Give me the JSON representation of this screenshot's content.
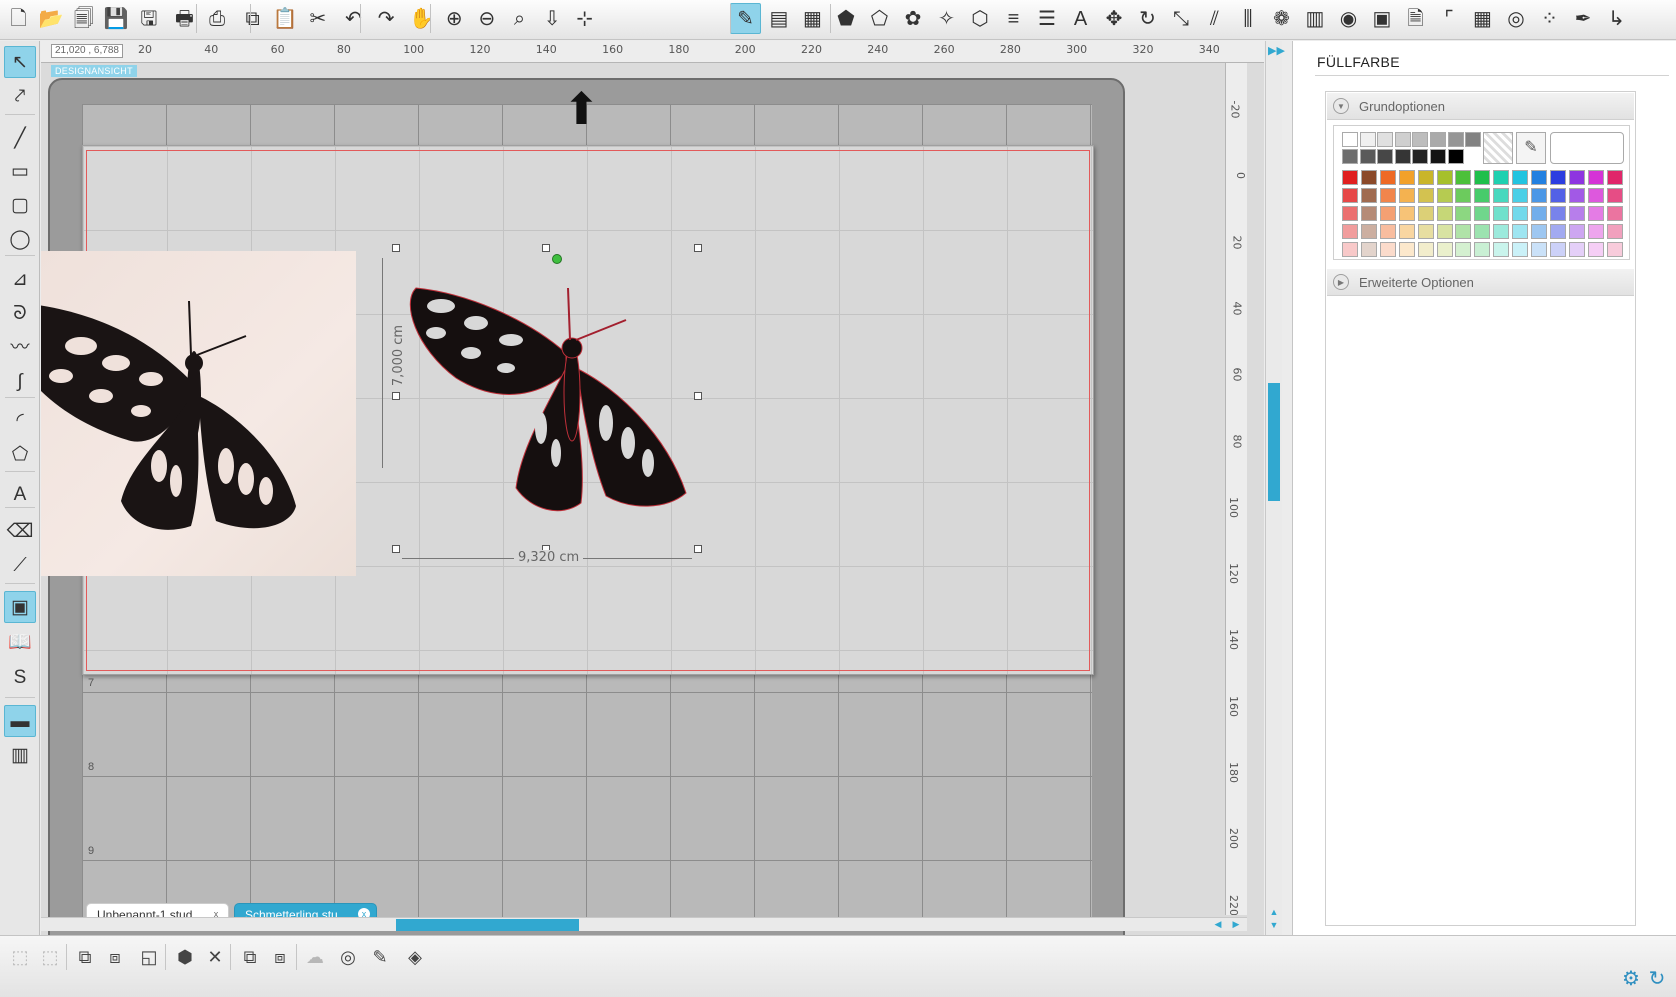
{
  "toolbar_left": [
    {
      "name": "new-document-icon",
      "glyph": "🗋"
    },
    {
      "name": "open-folder-icon",
      "glyph": "📂"
    },
    {
      "name": "open-template-icon",
      "glyph": "🗐"
    },
    {
      "name": "save-icon",
      "glyph": "💾"
    },
    {
      "name": "save-to-library-icon",
      "glyph": "🖫"
    },
    {
      "name": "print-icon",
      "glyph": "🖶"
    },
    {
      "name": "send-to-cutter-icon",
      "glyph": "⎙"
    },
    {
      "name": "copy-icon",
      "glyph": "⧉"
    },
    {
      "name": "paste-icon",
      "glyph": "📋"
    },
    {
      "name": "cut-icon",
      "glyph": "✂"
    },
    {
      "name": "undo-icon",
      "glyph": "↶"
    },
    {
      "name": "redo-icon",
      "glyph": "↷"
    },
    {
      "name": "pan-hand-icon",
      "glyph": "✋"
    },
    {
      "name": "zoom-in-icon",
      "glyph": "⊕"
    },
    {
      "name": "zoom-out-icon",
      "glyph": "⊖"
    },
    {
      "name": "zoom-selection-icon",
      "glyph": "⌕"
    },
    {
      "name": "drag-zoom-icon",
      "glyph": "⇩"
    },
    {
      "name": "fit-to-page-icon",
      "glyph": "⊹"
    }
  ],
  "toolbar_right": [
    {
      "name": "fill-color-icon",
      "glyph": "✎",
      "active": true
    },
    {
      "name": "fill-gradient-icon",
      "glyph": "▤"
    },
    {
      "name": "fill-pattern-icon",
      "glyph": "▦"
    },
    {
      "name": "line-color-icon",
      "glyph": "⬟"
    },
    {
      "name": "line-style-icon",
      "glyph": "⬠"
    },
    {
      "name": "line-dotted-icon",
      "glyph": "✿"
    },
    {
      "name": "shape-sketch-icon",
      "glyph": "✧"
    },
    {
      "name": "shape-outline-icon",
      "glyph": "⬡"
    },
    {
      "name": "line-weight-icon",
      "glyph": "≡"
    },
    {
      "name": "line-dash-icon",
      "glyph": "☰"
    },
    {
      "name": "text-style-icon",
      "glyph": "A"
    },
    {
      "name": "transform-move-icon",
      "glyph": "✥"
    },
    {
      "name": "rotate-icon",
      "glyph": "↻"
    },
    {
      "name": "scale-icon",
      "glyph": "⤡"
    },
    {
      "name": "shear-icon",
      "glyph": "⫽"
    },
    {
      "name": "align-icon",
      "glyph": "⫼"
    },
    {
      "name": "replicate-icon",
      "glyph": "❁"
    },
    {
      "name": "modify-icon",
      "glyph": "▥"
    },
    {
      "name": "offset-icon",
      "glyph": "◉"
    },
    {
      "name": "trace-icon",
      "glyph": "▣"
    },
    {
      "name": "page-setup-icon",
      "glyph": "🗎"
    },
    {
      "name": "registration-marks-icon",
      "glyph": "⌜"
    },
    {
      "name": "grid-icon",
      "glyph": "▦"
    },
    {
      "name": "spiral-offset-icon",
      "glyph": "◎"
    },
    {
      "name": "nesting-icon",
      "glyph": "⁘"
    },
    {
      "name": "sketch-pen-icon",
      "glyph": "✒"
    },
    {
      "name": "send-icon",
      "glyph": "↳"
    }
  ],
  "left_tools": [
    {
      "name": "select-tool-icon",
      "glyph": "↖",
      "active": true
    },
    {
      "name": "edit-points-tool-icon",
      "glyph": "⤤"
    },
    {
      "name": "line-tool-icon",
      "glyph": "╱"
    },
    {
      "name": "rectangle-tool-icon",
      "glyph": "▭"
    },
    {
      "name": "rounded-rectangle-tool-icon",
      "glyph": "▢"
    },
    {
      "name": "ellipse-tool-icon",
      "glyph": "◯"
    },
    {
      "name": "polyline-tool-icon",
      "glyph": "⊿"
    },
    {
      "name": "curve-tool-icon",
      "glyph": "ᘐ"
    },
    {
      "name": "freehand-tool-icon",
      "glyph": "〰"
    },
    {
      "name": "smooth-freehand-tool-icon",
      "glyph": "∫"
    },
    {
      "name": "arc-tool-icon",
      "glyph": "◜"
    },
    {
      "name": "polygon-tool-icon",
      "glyph": "⬠"
    },
    {
      "name": "text-tool-icon",
      "glyph": "A"
    },
    {
      "name": "eraser-tool-icon",
      "glyph": "⌫"
    },
    {
      "name": "knife-tool-icon",
      "glyph": "⟋"
    },
    {
      "name": "design-view-icon",
      "glyph": "▣",
      "active": true
    },
    {
      "name": "library-icon",
      "glyph": "📖"
    },
    {
      "name": "store-icon",
      "glyph": "S"
    },
    {
      "name": "split-view-icon",
      "glyph": "▬",
      "active": true
    },
    {
      "name": "two-pane-view-icon",
      "glyph": "▥"
    }
  ],
  "ruler": {
    "coordinates": "21,020 , 6,788",
    "h_ticks": [
      "20",
      "40",
      "60",
      "80",
      "100",
      "120",
      "140",
      "160",
      "180",
      "200",
      "220",
      "240",
      "260",
      "280",
      "300",
      "320",
      "340"
    ],
    "v_ticks": [
      "-20",
      "0",
      "20",
      "40",
      "60",
      "80",
      "100",
      "120",
      "140",
      "160",
      "180",
      "200",
      "220"
    ]
  },
  "view_label": "DESIGNANSICHT",
  "mat": {
    "row_numbers": [
      "7",
      "8",
      "9"
    ]
  },
  "selection": {
    "width_label": "9,320 cm",
    "height_label": "7,000 cm"
  },
  "tabs": [
    {
      "label": "Unbenannt-1.stud...",
      "close": "x",
      "active": false
    },
    {
      "label": "Schmetterling.stu...",
      "close": "x",
      "active": true
    }
  ],
  "panel": {
    "title": "FÜLLFARBE",
    "basic_options": "Grundoptionen",
    "advanced_options": "Erweiterte Optionen",
    "colors": {
      "grays": [
        "#ffffff",
        "#f0f0f0",
        "#e0e0e0",
        "#cfcfcf",
        "#bdbdbd",
        "#aaaaaa",
        "#969696",
        "#828282",
        "#6e6e6e",
        "#5a5a5a",
        "#474747",
        "#353535",
        "#232323",
        "#141414",
        "#000000"
      ],
      "hues": [
        "#e02020",
        "#8b4a2a",
        "#ee6a25",
        "#f2a12a",
        "#c9b52a",
        "#a6c02b",
        "#4cc03a",
        "#1fbf4b",
        "#1fd0b0",
        "#22c4e0",
        "#2380e0",
        "#2c3ee0",
        "#8e35e0",
        "#d533d6",
        "#e0266a"
      ],
      "lighten": [
        0.18,
        0.36,
        0.56,
        0.76
      ]
    }
  },
  "bottom_tools": [
    {
      "name": "group-icon",
      "glyph": "⬚",
      "disabled": true
    },
    {
      "name": "ungroup-icon",
      "glyph": "⬚",
      "disabled": true
    },
    {
      "name": "release-compound-icon",
      "glyph": "⧉"
    },
    {
      "name": "make-compound-icon",
      "glyph": "⧈"
    },
    {
      "name": "send-backward-icon",
      "glyph": "◱"
    },
    {
      "name": "bring-forward-icon",
      "glyph": "⬢"
    },
    {
      "name": "delete-icon",
      "glyph": "✕"
    },
    {
      "name": "bring-to-front-icon",
      "glyph": "⧉"
    },
    {
      "name": "send-to-back-icon",
      "glyph": "⧈"
    },
    {
      "name": "weld-icon",
      "glyph": "☁",
      "disabled": true
    },
    {
      "name": "offset-quick-icon",
      "glyph": "◎"
    },
    {
      "name": "trace-quick-icon",
      "glyph": "✎"
    },
    {
      "name": "shear-quick-icon",
      "glyph": "◈"
    }
  ],
  "bottom_right": [
    {
      "name": "settings-gear-icon",
      "glyph": "⚙"
    },
    {
      "name": "sync-icon",
      "glyph": "↻"
    }
  ]
}
